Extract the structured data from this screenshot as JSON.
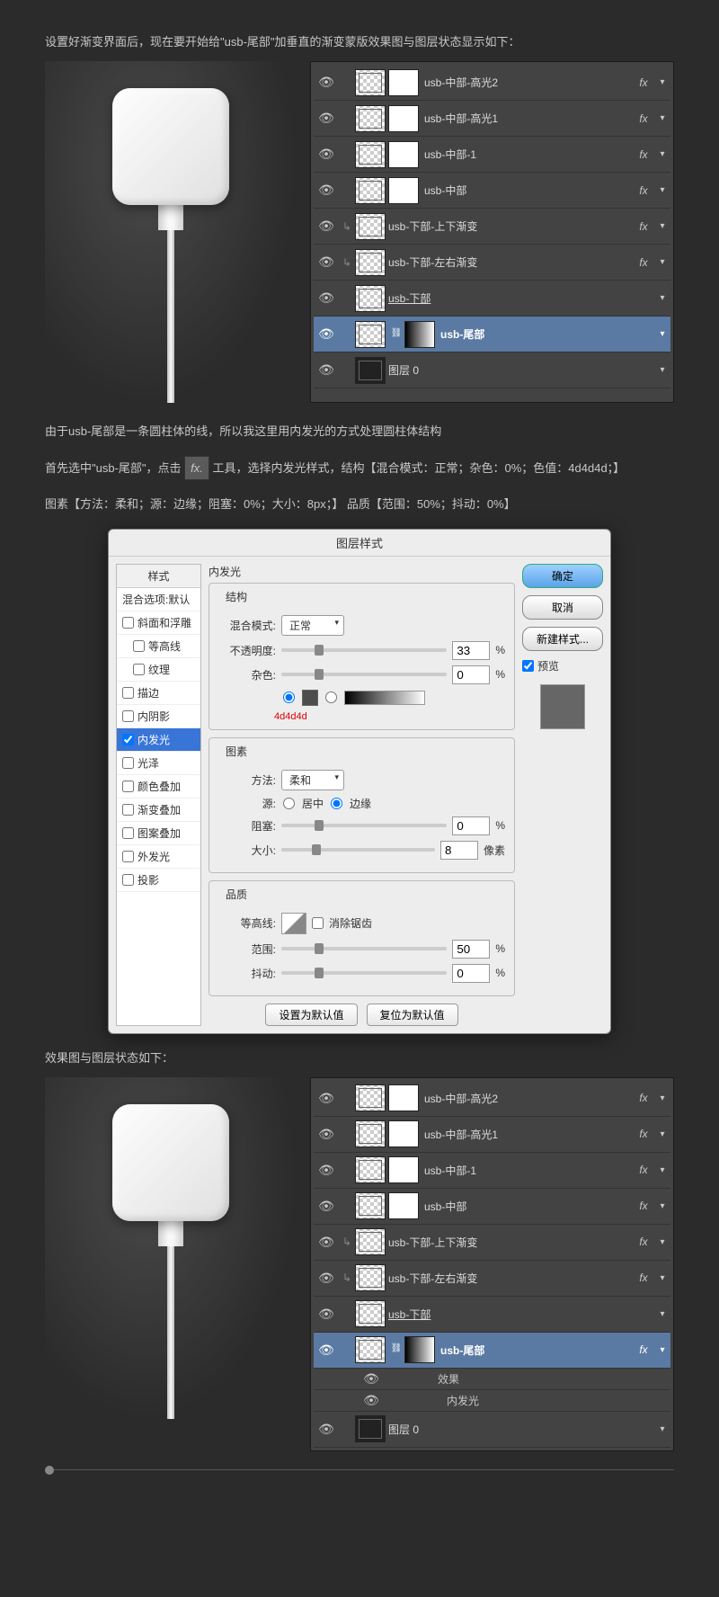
{
  "intro1": "设置好渐变界面后，现在要开始给\"usb-尾部\"加垂直的渐变蒙版效果图与图层状态显示如下：",
  "layers_panel_1": [
    {
      "name": "usb-中部-高光2",
      "fx": true,
      "mask": "white",
      "indent": 0
    },
    {
      "name": "usb-中部-高光1",
      "fx": true,
      "mask": "white",
      "indent": 0
    },
    {
      "name": "usb-中部-1",
      "fx": true,
      "mask": "white",
      "indent": 0
    },
    {
      "name": "usb-中部",
      "fx": true,
      "mask": "white",
      "indent": 0
    },
    {
      "name": "usb-下部-上下渐变",
      "fx": true,
      "mask": null,
      "indent": 1
    },
    {
      "name": "usb-下部-左右渐变",
      "fx": true,
      "mask": null,
      "indent": 1
    },
    {
      "name": "usb-下部",
      "fx": false,
      "mask": null,
      "indent": 0,
      "underline": true
    },
    {
      "name": "usb-尾部",
      "fx": false,
      "mask": "grad",
      "indent": 0,
      "selected": true,
      "link": true
    },
    {
      "name": "图层 0",
      "fx": false,
      "mask": null,
      "indent": 0,
      "dark": true
    }
  ],
  "mid_text_1": "由于usb-尾部是一条圆柱体的线，所以我这里用内发光的方式处理圆柱体结构",
  "mid_text_2a": "首先选中\"usb-尾部\"，点击",
  "mid_text_2b": "工具，选择内发光样式，结构【混合模式：正常；杂色：0%；色值：4d4d4d；】",
  "mid_text_3": "图素【方法：柔和；源：边缘；阻塞：0%；大小：8px；】 品质【范围：50%；抖动：0%】",
  "fx_label": "fx.",
  "dialog": {
    "title": "图层样式",
    "styles_header": "样式",
    "blend_default": "混合选项:默认",
    "style_items": [
      {
        "label": "斜面和浮雕",
        "checked": false
      },
      {
        "label": "等高线",
        "checked": false,
        "indent": true
      },
      {
        "label": "纹理",
        "checked": false,
        "indent": true
      },
      {
        "label": "描边",
        "checked": false
      },
      {
        "label": "内阴影",
        "checked": false
      },
      {
        "label": "内发光",
        "checked": true,
        "active": true
      },
      {
        "label": "光泽",
        "checked": false
      },
      {
        "label": "颜色叠加",
        "checked": false
      },
      {
        "label": "渐变叠加",
        "checked": false
      },
      {
        "label": "图案叠加",
        "checked": false
      },
      {
        "label": "外发光",
        "checked": false
      },
      {
        "label": "投影",
        "checked": false
      }
    ],
    "panel_title": "内发光",
    "group_structure": "结构",
    "blend_mode_label": "混合模式:",
    "blend_mode_value": "正常",
    "opacity_label": "不透明度:",
    "opacity_value": "33",
    "noise_label": "杂色:",
    "noise_value": "0",
    "color_note": "4d4d4d",
    "group_elements": "图素",
    "technique_label": "方法:",
    "technique_value": "柔和",
    "source_label": "源:",
    "source_center": "居中",
    "source_edge": "边缘",
    "choke_label": "阻塞:",
    "choke_value": "0",
    "size_label": "大小:",
    "size_value": "8",
    "size_unit": "像素",
    "group_quality": "品质",
    "contour_label": "等高线:",
    "antialias_label": "消除锯齿",
    "range_label": "范围:",
    "range_value": "50",
    "jitter_label": "抖动:",
    "jitter_value": "0",
    "percent": "%",
    "btn_default": "设置为默认值",
    "btn_reset": "复位为默认值",
    "btn_ok": "确定",
    "btn_cancel": "取消",
    "btn_newstyle": "新建样式...",
    "preview_label": "预览"
  },
  "outro": "效果图与图层状态如下：",
  "layers_panel_2_extra": {
    "effects_label": "效果",
    "inner_glow_label": "内发光"
  }
}
